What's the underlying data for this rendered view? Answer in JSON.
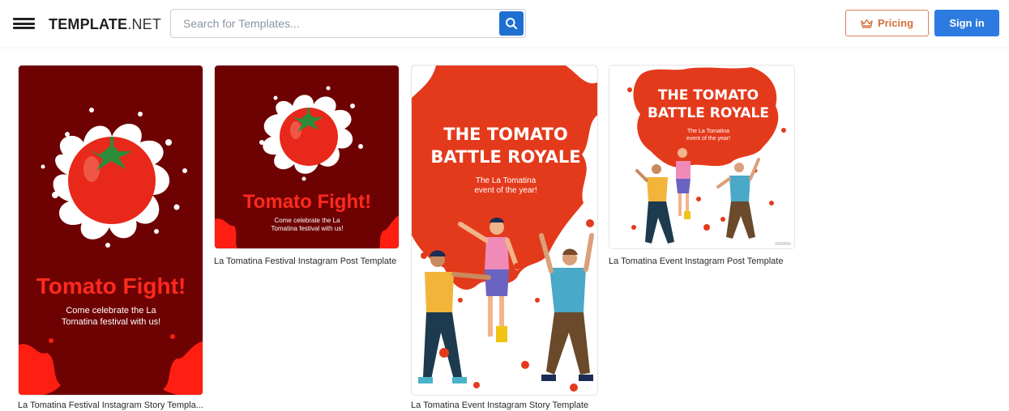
{
  "header": {
    "logo_bold": "TEMPLATE",
    "logo_light": ".NET",
    "search_placeholder": "Search for Templates...",
    "pricing_label": "Pricing",
    "signin_label": "Sign in"
  },
  "templates": [
    {
      "caption": "La Tomatina Festival Instagram Story Templa...",
      "headline": "Tomato Fight!",
      "subtext_line1": "Come celebrate the La",
      "subtext_line2": "Tomatina festival with us!"
    },
    {
      "caption": "La Tomatina Festival Instagram Post Template",
      "headline": "Tomato Fight!",
      "subtext_line1": "Come celebrate the La",
      "subtext_line2": "Tomatina festival with us!"
    },
    {
      "caption": "La Tomatina Event Instagram Story Template",
      "headline_line1": "THE TOMATO",
      "headline_line2": "BATTLE ROYALE",
      "subtext_line1": "The La Tomatina",
      "subtext_line2": "event of the year!"
    },
    {
      "caption": "La Tomatina Event Instagram Post Template",
      "headline_line1": "THE TOMATO",
      "headline_line2": "BATTLE ROYALE",
      "subtext_line1": "The La Tomatina",
      "subtext_line2": "event of the year!"
    }
  ],
  "colors": {
    "maroon": "#6e0202",
    "tomato": "#e8281a",
    "splash_red": "#e43a1c",
    "brand_blue": "#2d7be0",
    "pricing_orange": "#d2713d"
  },
  "icons": {
    "menu": "hamburger-icon",
    "search": "search-icon",
    "pricing": "crown-icon"
  }
}
